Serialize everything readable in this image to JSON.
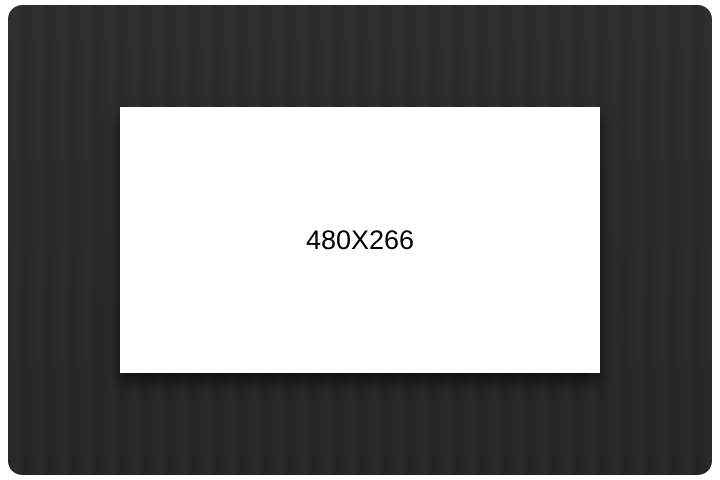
{
  "viewer": {
    "image_placeholder": {
      "label": "480X266"
    },
    "colors": {
      "frame_background": "#2a2a2a",
      "image_background": "#ffffff",
      "label_color": "#000000"
    }
  }
}
